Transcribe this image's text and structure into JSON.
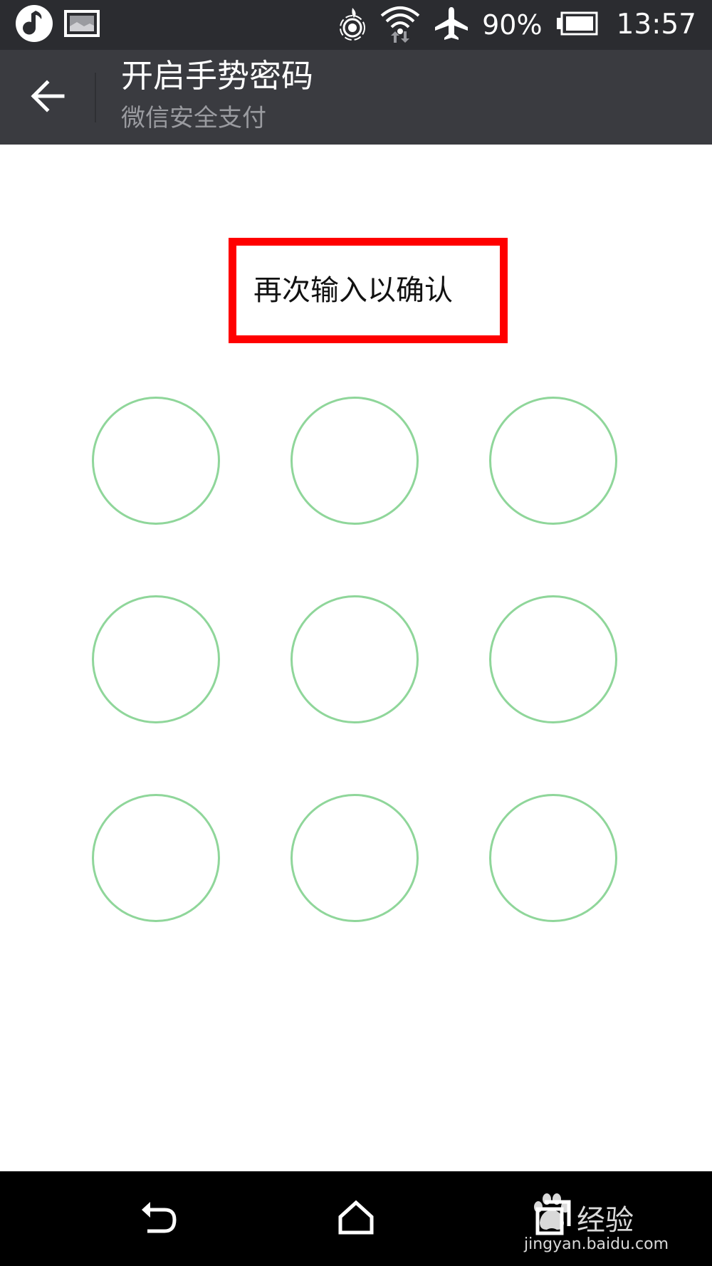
{
  "status_bar": {
    "battery_percent": "90%",
    "time": "13:57",
    "icons": [
      "music-app-icon",
      "gallery-notification-icon",
      "location-beacon-icon",
      "wifi-icon",
      "airplane-mode-icon",
      "battery-icon"
    ]
  },
  "header": {
    "title": "开启手势密码",
    "subtitle": "微信安全支付"
  },
  "prompt": {
    "text": "再次输入以确认",
    "highlight_color": "#ff0000"
  },
  "gesture_grid": {
    "rows": 3,
    "cols": 3,
    "dot_color": "#8fd69a"
  },
  "nav_bar": {
    "buttons": [
      "back",
      "home",
      "recents"
    ]
  },
  "watermark": {
    "brand": "经验",
    "url": "jingyan.baidu.com"
  }
}
